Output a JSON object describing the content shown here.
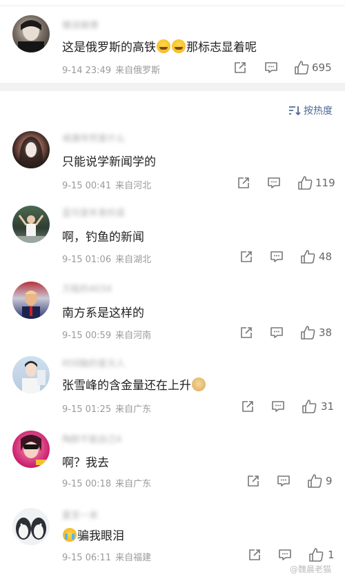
{
  "pinned_comment": {
    "username": "懒派微博",
    "text": "这是俄罗斯的高铁",
    "emojis": [
      "laugh-emoji",
      "laugh-emoji"
    ],
    "text_after": "那标志显着呢",
    "time": "9-14 23:49",
    "location": "来自俄罗斯",
    "likes": "695"
  },
  "sort": {
    "label": "按热度",
    "icon": "sort-icon"
  },
  "comments": [
    {
      "username": "戒偶爷然爱什么",
      "prefix": "",
      "text": "只能说学新闻学的",
      "time": "9-15 00:41",
      "location": "来自河北",
      "likes": "119"
    },
    {
      "username": "蓝可是年青的诺",
      "prefix": "",
      "text": "啊，钓鱼的新闻",
      "time": "9-15 01:06",
      "location": "来自湖北",
      "likes": "48"
    },
    {
      "username": "万般的4034",
      "prefix": "",
      "text": "南方系是这样的",
      "time": "9-15 00:59",
      "location": "来自河南",
      "likes": "38"
    },
    {
      "username": "时间脑的星光人",
      "prefix": "",
      "text": "张雪峰的含金量还在上升",
      "time": "9-15 01:25",
      "location": "来自广东",
      "likes": "31"
    },
    {
      "username": "陶醉不能自己4",
      "prefix": "",
      "text": "啊？我去",
      "time": "9-15 00:18",
      "location": "来自广东",
      "likes": "9"
    },
    {
      "username": "夏至一来",
      "prefix": "",
      "text": "骗我眼泪",
      "time": "9-15 06:11",
      "location": "来自福建",
      "likes": "1"
    }
  ],
  "watermark": "@魏晨老猫",
  "colors": {
    "accent": "#4a6a94",
    "meta": "#9a9a9a",
    "band": "#f2f2f2"
  }
}
